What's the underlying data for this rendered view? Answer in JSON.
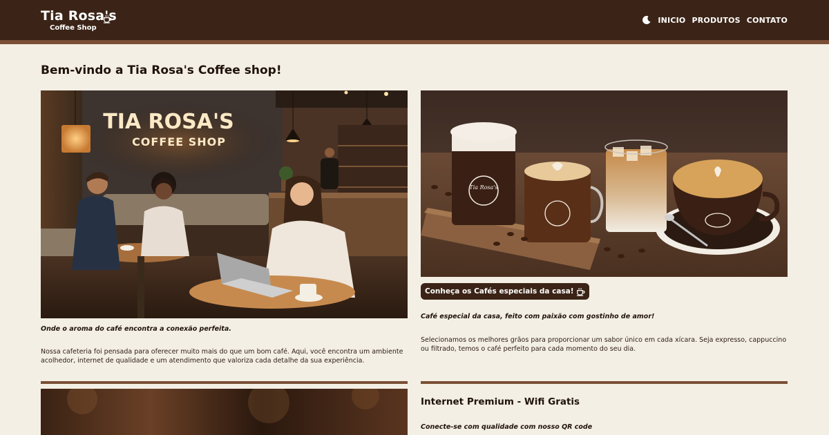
{
  "header": {
    "brand_title": "Tia Rosa's",
    "brand_subtitle": "Coffee Shop",
    "nav": [
      {
        "label": "INICIO"
      },
      {
        "label": "PRODUTOS"
      },
      {
        "label": "CONTATO"
      }
    ],
    "icons": [
      "coffee-cup-icon",
      "moon-icon"
    ]
  },
  "main": {
    "title": "Bem-vindo a Tia Rosa's Coffee shop!",
    "left": {
      "sign_line1": "TIA ROSA'S",
      "sign_line2": "COFFEE SHOP",
      "caption": "Onde o aroma do café encontra a conexão perfeita.",
      "body": "Nossa cafeteria foi pensada para oferecer muito mais do que um bom café. Aqui, você encontra um ambiente acolhedor, internet de qualidade e um atendimento que valoriza cada detalhe da sua experiência."
    },
    "right": {
      "cup_label": "Tia Rosa's",
      "cup_sublabel": "COFFEE SHOP",
      "button_label": "Conheça os Cafés especiais da casa!",
      "caption": "Café especial da casa, feito com paixão com gostinho de amor!",
      "body": "Selecionamos os melhores grãos para proporcionar um sabor único em cada xícara. Seja expresso, cappuccino ou filtrado, temos o café perfeito para cada momento do seu dia."
    },
    "wifi": {
      "title": "Internet Premium - Wifi Gratis",
      "caption": "Conecte-se com qualidade com nosso QR code"
    }
  },
  "colors": {
    "header_bg": "#3b2417",
    "accent": "#7a4f35",
    "page_bg": "#f4efe5"
  }
}
